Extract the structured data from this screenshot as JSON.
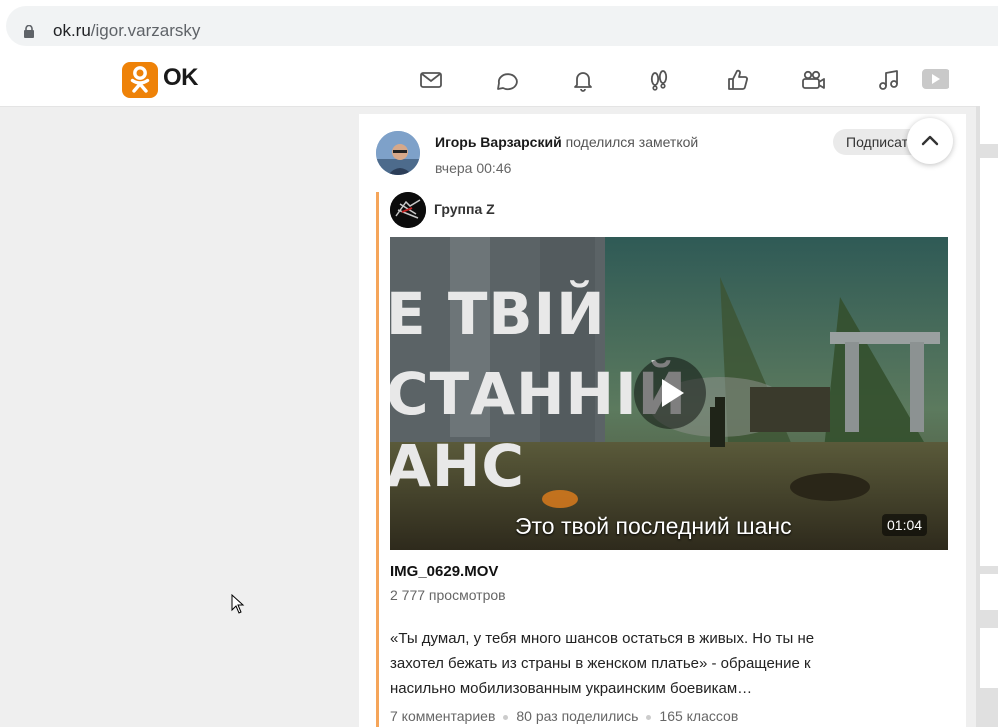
{
  "browser": {
    "url_domain": "ok.ru",
    "url_path": "/igor.varzarsky"
  },
  "nav": {
    "logo_text": "OK",
    "icons": [
      "messages-icon",
      "discussions-icon",
      "notifications-icon",
      "guests-icon",
      "likes-icon",
      "video-icon",
      "music-icon",
      "video-play-icon"
    ]
  },
  "post": {
    "author": "Игорь Варзарский",
    "action": "поделился заметкой",
    "time": "вчера 00:46",
    "subscribe_label": "Подписаться",
    "group_name": "Группа Z",
    "video": {
      "overlay_lines": [
        "Е ТВІЙ",
        "СТАННІЙ",
        "АНС"
      ],
      "subtitle": "Это твой последний шанс",
      "duration": "01:04"
    },
    "video_title": "IMG_0629.MOV",
    "views": "2 777 просмотров",
    "description": "«Ты думал, у тебя много шансов остаться в живых. Но ты не захотел бежать из страны в женском платье» - обращение к насильно мобилизованным украинским боевикам…",
    "stats": {
      "comments": "7 комментариев",
      "shares": "80 раз поделились",
      "likes": "165 классов"
    }
  },
  "colors": {
    "accent": "#ee8208",
    "quote_line": "#f5a55a",
    "page_bg": "#efefef"
  }
}
